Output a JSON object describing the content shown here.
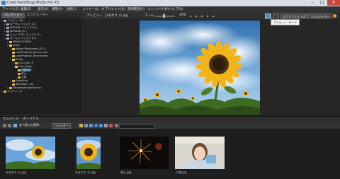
{
  "window": {
    "title": "Corel PaintShop Photo Pro X3",
    "minimize": "–",
    "maximize": "□",
    "close": "✕"
  },
  "menu": [
    "ファイル(F)",
    "編集(E)",
    "表示(V)",
    "調整(A)",
    "効果(C)",
    "レイヤー(L)",
    "オブジェクト(O)",
    "選択範囲(S)",
    "ウィンドウ(W)",
    "ヘルプ(H)"
  ],
  "left_tabs": {
    "collection": "コレクション",
    "computer": "コンピューター"
  },
  "tree": [
    {
      "label": "コンピューター",
      "icon": "computer-icon"
    },
    {
      "label": "ローカル ディスク (C:)",
      "icon": "drive-icon"
    },
    {
      "label": "DVD-RW ドライブ (D:)",
      "icon": "drive-icon"
    },
    {
      "label": "Windows (E:)",
      "icon": "drive-icon"
    },
    {
      "label": "リムーバブル ディスク (F:)",
      "icon": "drive-icon"
    },
    {
      "label": "ローカル ディスク (G:)",
      "icon": "drive-icon"
    },
    {
      "label": "MINUS-TOWER",
      "icon": "folder-icon"
    },
    {
      "label": "temp",
      "icon": "folder-icon"
    },
    {
      "label": "Adobe Photoshop CS5.1",
      "icon": "folder-icon"
    },
    {
      "label": "LosePhotoX1_Benchmark",
      "icon": "folder-icon"
    },
    {
      "label": "LosePhotoX2_Benchmark",
      "icon": "folder-icon"
    },
    {
      "label": "Photo",
      "icon": "folder-icon"
    },
    {
      "label": "2011-08-15",
      "icon": "folder-icon"
    },
    {
      "label": "Free_Photo",
      "icon": "folder-icon"
    },
    {
      "label": "ひまわり",
      "icon": "folder-icon"
    },
    {
      "label": "花火",
      "icon": "folder-icon"
    },
    {
      "label": "人物",
      "icon": "folder-icon"
    },
    {
      "label": "SnapShot",
      "icon": "folder-icon"
    },
    {
      "label": "WinVista7_64",
      "icon": "folder-icon"
    },
    {
      "label": "WindowsImageBackup",
      "icon": "folder-icon"
    },
    {
      "label": "デスクトップ",
      "icon": "folder-icon"
    }
  ],
  "preview_toolbar": {
    "preview": "プレビュー",
    "filename": "ひまわり 小.jpg",
    "zoom_label": "ズーム",
    "zoom_value": "29%",
    "express_mode": "エクスプレス ラボ",
    "full_editor": "フルエディター",
    "tooltip": "プレビュー モード"
  },
  "bottom_tabs": {
    "thumbnails": "サムネイル",
    "original": "オリジナル"
  },
  "bottom_toolbar": {
    "sort": "並べ替えの基準:",
    "sort_value": "フォルダー"
  },
  "thumbnails": [
    {
      "caption": "ひまわり 小.jpg"
    },
    {
      "caption": "ひまわり 大.jpg"
    },
    {
      "caption": "花火.jpg"
    },
    {
      "caption": "人物.jpg"
    }
  ]
}
